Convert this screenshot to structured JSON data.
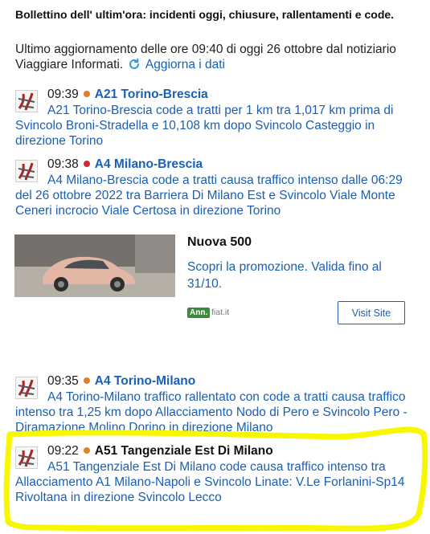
{
  "bulletin": {
    "title": "Bollettino dell' ultim'ora: incidenti oggi, chiusure, rallentamenti e code.",
    "update_text": "Ultimo aggiornamento delle ore 09:40 di oggi 26 ottobre dal notiziario Viaggiare Informati.",
    "refresh_label": "Aggiorna i dati",
    "refresh_icon": "refresh-icon"
  },
  "incidents": [
    {
      "time": "09:39",
      "dot_color": "#d9822b",
      "road": "A21 Torino-Brescia",
      "description": "A21 Torino-Brescia code a tratti per 1 km tra 1,017 km prima di Svincolo Broni-Stradella e 10,108 km dopo Svincolo Casteggio in direzione Torino"
    },
    {
      "time": "09:38",
      "dot_color": "#cc2b2b",
      "road": "A4 Milano-Brescia",
      "description": "A4 Milano-Brescia code a tratti causa traffico intenso dalle 06:29 del 26 ottobre 2022 tra Barriera Di Milano Est e Svincolo Viale Monte Ceneri incrocio Viale Certosa in direzione Torino"
    },
    {
      "time": "09:35",
      "dot_color": "#d9822b",
      "road": "A4 Torino-Milano",
      "description": "A4 Torino-Milano traffico rallentato con code a tratti causa traffico intenso tra 1,25 km dopo Allacciamento Nodo di Pero e Svincolo Pero - Diramazione Molino Dorino in direzione Milano"
    },
    {
      "time": "09:22",
      "dot_color": "#d9822b",
      "road": "A51 Tangenziale Est Di Milano",
      "description": "A51 Tangenziale Est Di Milano code causa traffico intenso tra Allacciamento A1 Milano-Napoli e Svincolo Linate: V.Le Forlanini-Sp14 Rivoltana in direzione Svincolo Lecco"
    }
  ],
  "ad": {
    "title": "Nuova 500",
    "text": "Scopri la promozione. Valida fino al 31/10.",
    "badge": "Ann.",
    "domain": "fiat.it",
    "button_label": "Visit Site"
  },
  "colors": {
    "link": "#1a5fb4",
    "highlight": "#f7f700",
    "ad_badge": "#3c8b3c"
  }
}
